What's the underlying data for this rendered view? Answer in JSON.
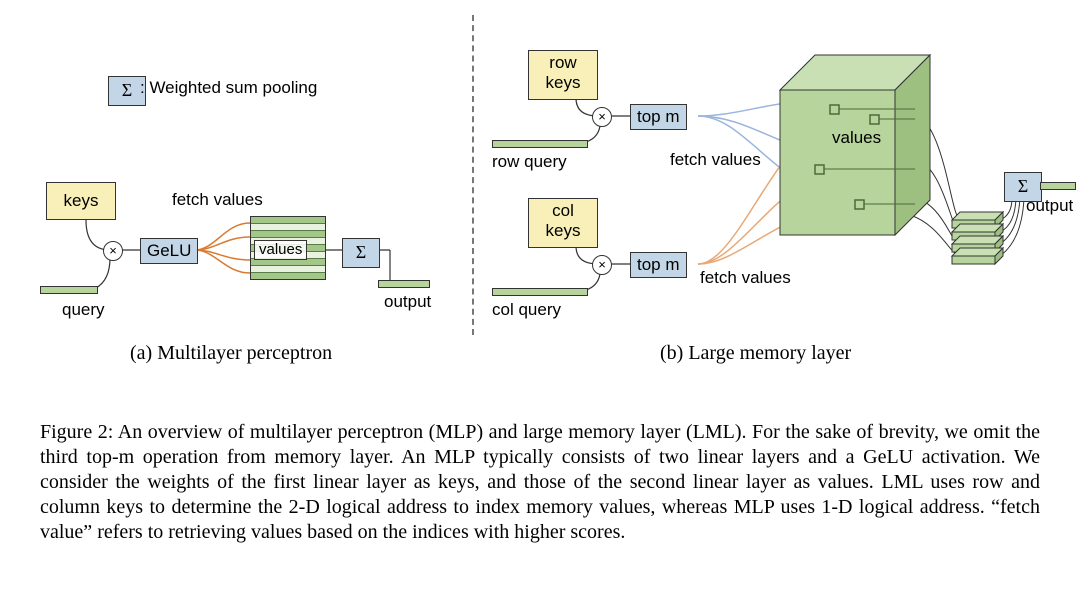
{
  "legend": {
    "sigma": "Σ",
    "desc": ": Weighted sum pooling"
  },
  "mlp": {
    "keys": "keys",
    "gelu": "GeLU",
    "fetch": "fetch values",
    "values": "values",
    "sigma": "Σ",
    "output": "output",
    "query": "query",
    "caption": "(a)  Multilayer perceptron"
  },
  "lml": {
    "row_keys_l1": "row",
    "row_keys_l2": "keys",
    "row_query": "row query",
    "col_keys_l1": "col",
    "col_keys_l2": "keys",
    "col_query": "col query",
    "topm1": "top m",
    "topm2": "top m",
    "fetch1": "fetch values",
    "fetch2": "fetch values",
    "values": "values",
    "sigma": "Σ",
    "output": "output",
    "caption": "(b)  Large memory layer"
  },
  "figcaption": "Figure 2: An overview of multilayer perceptron (MLP) and large memory layer (LML). For the sake of brevity, we omit the third top-m operation from memory layer. An MLP typically consists of two linear layers and a GeLU activation. We consider the weights of the first linear layer as keys, and those of the second linear layer as values. LML uses row and column keys to determine the 2-D logical address to index memory values, whereas MLP uses 1-D logical address. “fetch value” refers to retrieving values based on the indices with higher scores."
}
